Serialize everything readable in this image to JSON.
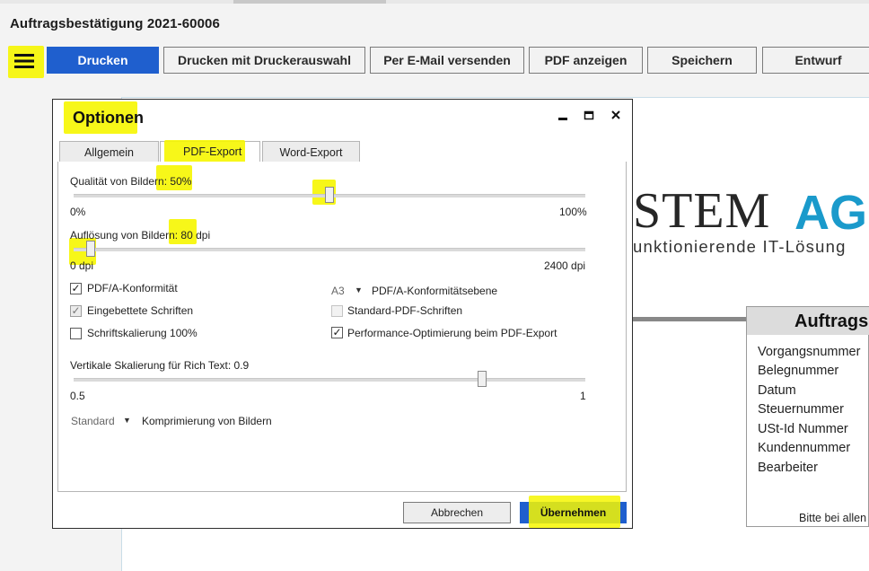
{
  "window": {
    "title": "Auftragsbestätigung 2021-60006"
  },
  "toolbar": {
    "menu_icon": "hamburger-menu-icon",
    "buttons": [
      "Drucken",
      "Drucken mit Druckerauswahl",
      "Per E-Mail versenden",
      "PDF anzeigen",
      "Speichern",
      "Entwurf"
    ]
  },
  "document": {
    "logo_main": "STEM",
    "logo_accent": "AG",
    "logo_sub": "unktionierende IT-Lösung",
    "box_title": "Auftrags",
    "box_rows": [
      "Vorgangsnummer",
      "Belegnummer",
      "Datum",
      "Steuernummer",
      "USt-Id Nummer",
      "Kundennummer",
      "Bearbeiter"
    ],
    "box_footer": "Bitte bei allen"
  },
  "dialog": {
    "title": "Optionen",
    "window_controls": {
      "minimize": "minimize-icon",
      "maximize": "maximize-icon",
      "close": "close-icon"
    },
    "tabs": [
      "Allgemein",
      "PDF-Export",
      "Word-Export"
    ],
    "active_tab": "PDF-Export",
    "quality": {
      "label": "Qualität von Bildern: 50%",
      "min": "0%",
      "max": "100%",
      "value": 0.5
    },
    "resolution": {
      "label": "Auflösung von Bildern: 80 dpi",
      "min": "0 dpi",
      "max": "2400 dpi",
      "value": 80
    },
    "checkboxes_left": [
      {
        "label": "PDF/A-Konformität",
        "checked": true,
        "state": "enabled"
      },
      {
        "label": "Eingebettete Schriften",
        "checked": true,
        "state": "grayed"
      },
      {
        "label": "Schriftskalierung 100%",
        "checked": false,
        "state": "enabled"
      }
    ],
    "pdfa_level": {
      "value": "A3",
      "label": "PDF/A-Konformitätsebene"
    },
    "checkboxes_right": [
      {
        "label": "Standard-PDF-Schriften",
        "checked": false,
        "state": "disabled"
      },
      {
        "label": "Performance-Optimierung beim PDF-Export",
        "checked": true,
        "state": "enabled"
      }
    ],
    "rich_text_scale": {
      "label": "Vertikale Skalierung für Rich Text: 0.9",
      "min": "0.5",
      "max": "1",
      "value": 0.9
    },
    "compression": {
      "value": "Standard",
      "label": "Komprimierung von Bildern"
    },
    "buttons": {
      "cancel": "Abbrechen",
      "apply": "Übernehmen"
    }
  },
  "highlight_color": "#f6f600",
  "accent_color": "#1f5fce"
}
